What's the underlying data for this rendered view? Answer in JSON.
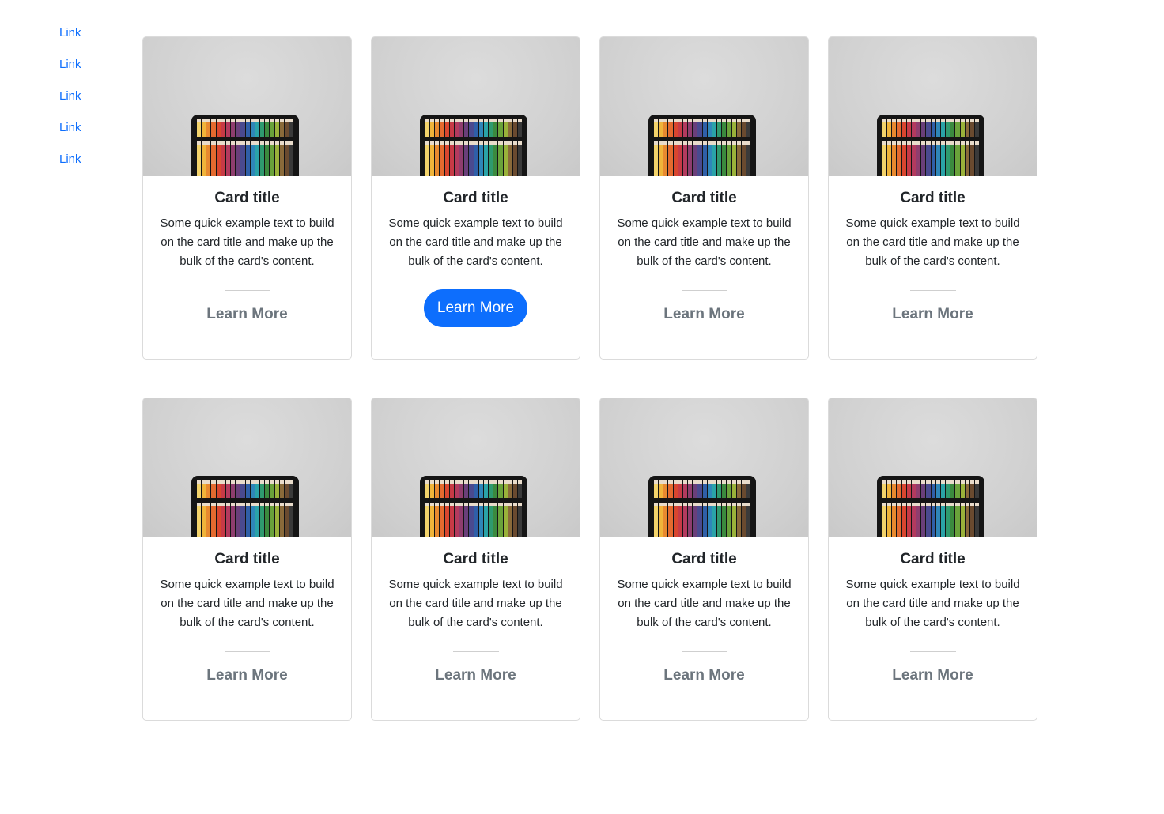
{
  "sidebar": {
    "links": [
      "Link",
      "Link",
      "Link",
      "Link",
      "Link"
    ]
  },
  "cards": [
    {
      "title": "Card title",
      "text": "Some quick example text to build on the card title and make up the bulk of the card's content.",
      "button": "Learn More",
      "button_active": false
    },
    {
      "title": "Card title",
      "text": "Some quick example text to build on the card title and make up the bulk of the card's content.",
      "button": "Learn More",
      "button_active": true
    },
    {
      "title": "Card title",
      "text": "Some quick example text to build on the card title and make up the bulk of the card's content.",
      "button": "Learn More",
      "button_active": false
    },
    {
      "title": "Card title",
      "text": "Some quick example text to build on the card title and make up the bulk of the card's content.",
      "button": "Learn More",
      "button_active": false
    },
    {
      "title": "Card title",
      "text": "Some quick example text to build on the card title and make up the bulk of the card's content.",
      "button": "Learn More",
      "button_active": false
    },
    {
      "title": "Card title",
      "text": "Some quick example text to build on the card title and make up the bulk of the card's content.",
      "button": "Learn More",
      "button_active": false
    },
    {
      "title": "Card title",
      "text": "Some quick example text to build on the card title and make up the bulk of the card's content.",
      "button": "Learn More",
      "button_active": false
    },
    {
      "title": "Card title",
      "text": "Some quick example text to build on the card title and make up the bulk of the card's content.",
      "button": "Learn More",
      "button_active": false
    }
  ],
  "colors": {
    "link": "#0d6efd",
    "button_active_bg": "#0d6efd",
    "learn_more_text": "#6c757d"
  },
  "image": {
    "subject": "colored-pencils-tray-image"
  }
}
